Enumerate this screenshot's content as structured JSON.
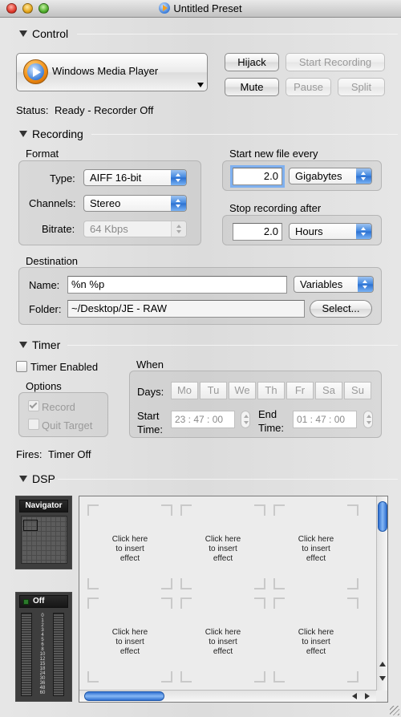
{
  "window": {
    "title": "Untitled Preset"
  },
  "control": {
    "section_label": "Control",
    "source_popup": "Windows Media Player",
    "hijack": "Hijack",
    "start_recording": "Start Recording",
    "mute": "Mute",
    "pause": "Pause",
    "split": "Split",
    "status_label": "Status:",
    "status_value": "Ready - Recorder Off"
  },
  "recording": {
    "section_label": "Recording",
    "format": {
      "group_label": "Format",
      "type_label": "Type:",
      "type_value": "AIFF 16-bit",
      "channels_label": "Channels:",
      "channels_value": "Stereo",
      "bitrate_label": "Bitrate:",
      "bitrate_value": "64 Kbps"
    },
    "start_new_file": {
      "group_label": "Start new file every",
      "value": "2.0",
      "unit": "Gigabytes"
    },
    "stop_after": {
      "group_label": "Stop recording after",
      "value": "2.0",
      "unit": "Hours"
    },
    "destination": {
      "group_label": "Destination",
      "name_label": "Name:",
      "name_value": "%n %p",
      "variables": "Variables",
      "folder_label": "Folder:",
      "folder_value": "~/Desktop/JE - RAW",
      "select": "Select..."
    }
  },
  "timer": {
    "section_label": "Timer",
    "enabled_label": "Timer Enabled",
    "options_label": "Options",
    "record_label": "Record",
    "quit_label": "Quit Target",
    "when_label": "When",
    "days_label": "Days:",
    "days": [
      "Mo",
      "Tu",
      "We",
      "Th",
      "Fr",
      "Sa",
      "Su"
    ],
    "start_label_1": "Start",
    "start_label_2": "Time:",
    "start_time": "23 : 47 : 00",
    "end_label_1": "End",
    "end_label_2": "Time:",
    "end_time": "01 : 47 : 00",
    "fires_label": "Fires:",
    "fires_value": "Timer Off"
  },
  "dsp": {
    "section_label": "DSP",
    "navigator": "Navigator",
    "meter_toggle": "Off",
    "meter_scale": [
      "0",
      "1",
      "2",
      "3",
      "4",
      "5",
      "6",
      "8",
      "10",
      "12",
      "15",
      "18",
      "24",
      "30",
      "36",
      "48",
      "60"
    ],
    "slots": [
      {
        "line1": "Click here",
        "line2": "to insert",
        "line3": "effect"
      },
      {
        "line1": "Click here",
        "line2": "to insert",
        "line3": "effect"
      },
      {
        "line1": "Click here",
        "line2": "to insert",
        "line3": "effect"
      },
      {
        "line1": "Click here",
        "line2": "to insert",
        "line3": "effect"
      },
      {
        "line1": "Click here",
        "line2": "to insert",
        "line3": "effect"
      },
      {
        "line1": "Click here",
        "line2": "to insert",
        "line3": "effect"
      }
    ]
  }
}
